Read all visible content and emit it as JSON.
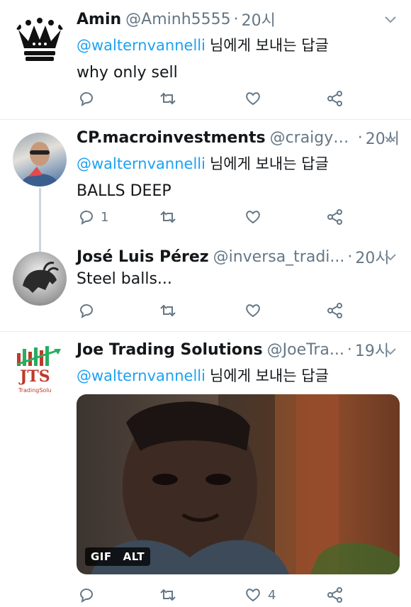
{
  "tweets": [
    {
      "name": "Amin",
      "handle": "@Aminh5555",
      "dot": "·",
      "time": "20시",
      "reply_handle": "@walternvannelli",
      "reply_text": "님에게 보내는 답글",
      "text": "why only sell",
      "counts": {
        "reply": "",
        "retweet": "",
        "like": ""
      }
    },
    {
      "name": "CP.macroinvestments",
      "handle": "@craigyy...",
      "dot": "·",
      "time": "20시",
      "reply_handle": "@walternvannelli",
      "reply_text": "님에게 보내는 답글",
      "text": "BALLS DEEP",
      "counts": {
        "reply": "1",
        "retweet": "",
        "like": ""
      }
    },
    {
      "name": "José Luis Pérez",
      "handle": "@inversa_tradi...",
      "dot": "·",
      "time": "20시",
      "text": "Steel balls...",
      "counts": {
        "reply": "",
        "retweet": "",
        "like": ""
      }
    },
    {
      "name": "Joe Trading Solutions",
      "handle": "@JoeTra...",
      "dot": "·",
      "time": "19시",
      "reply_handle": "@walternvannelli",
      "reply_text": "님에게 보내는 답글",
      "media_badges": [
        "GIF",
        "ALT"
      ],
      "counts": {
        "reply": "",
        "retweet": "",
        "like": "4"
      }
    }
  ],
  "logo": {
    "jts": "JTS",
    "jts_sub": "TradingSolu"
  },
  "colors": {
    "link": "#1da1f2",
    "muted": "#657786",
    "divider": "#e6ecf0"
  }
}
